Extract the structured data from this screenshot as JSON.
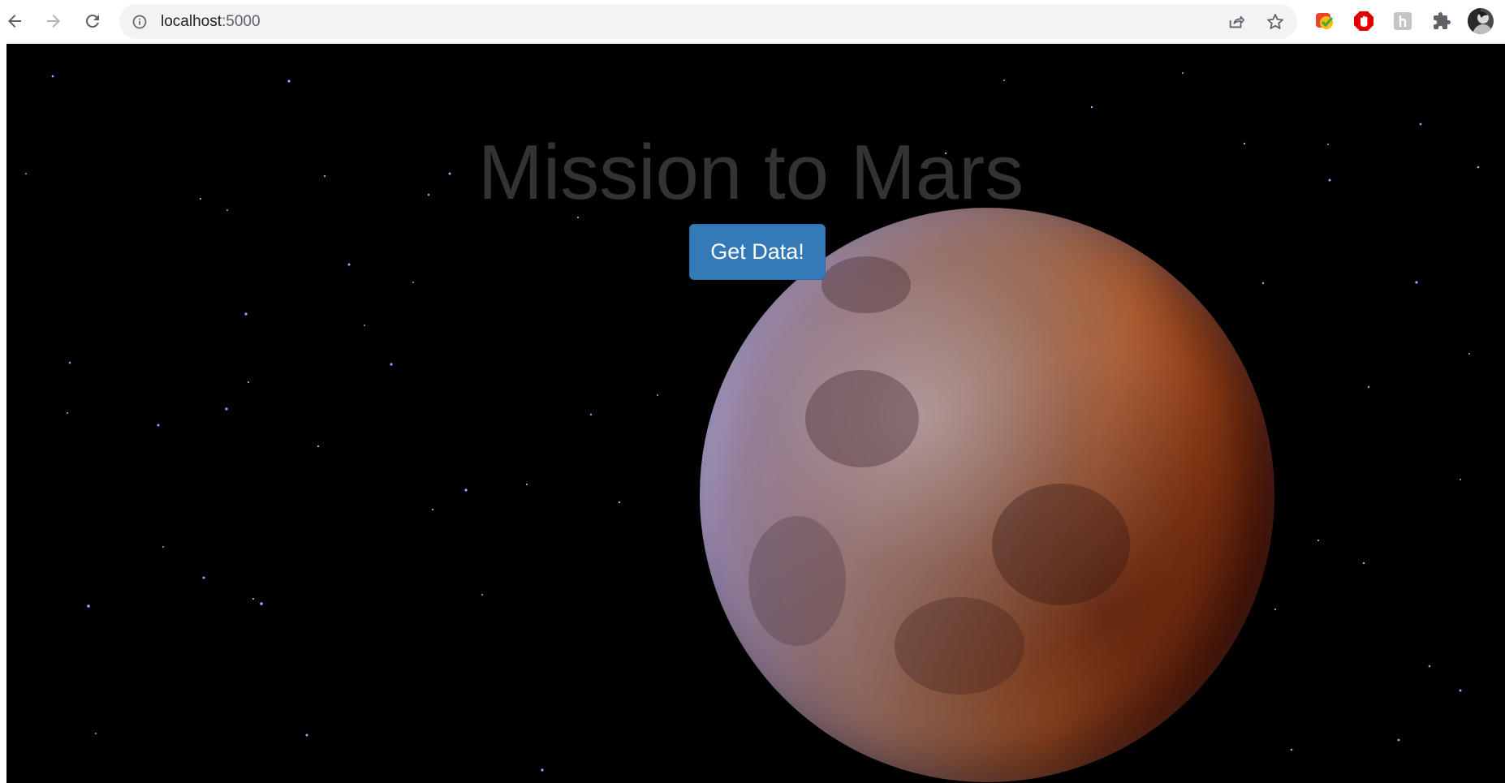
{
  "browser": {
    "url_host": "localhost",
    "url_port": ":5000",
    "icons": {
      "back": "back-arrow-icon",
      "forward": "forward-arrow-icon",
      "reload": "reload-icon",
      "info": "info-icon",
      "share": "share-icon",
      "bookmark": "star-icon",
      "extensions": "puzzle-icon"
    }
  },
  "page": {
    "title": "Mission to Mars",
    "button_label": "Get Data!",
    "accent_color": "#337ab7",
    "background_color": "#000000"
  }
}
